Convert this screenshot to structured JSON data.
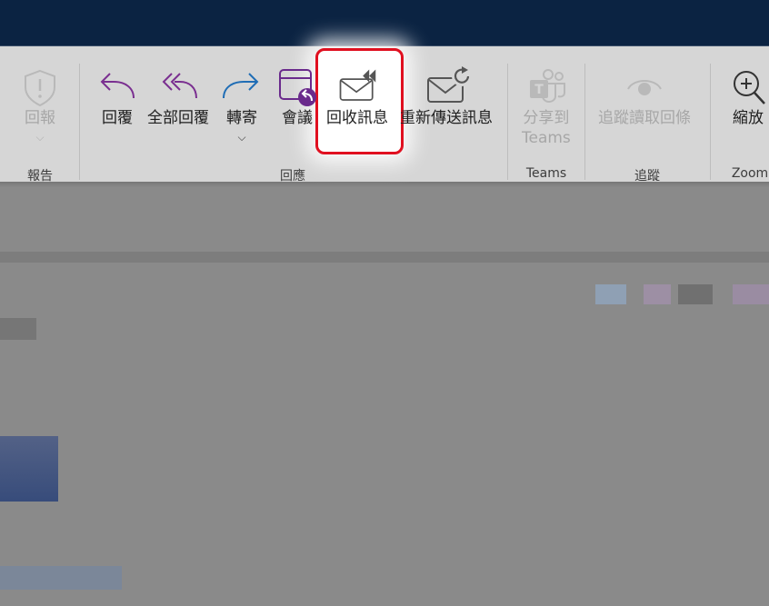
{
  "ribbon": {
    "report": {
      "label": "回報",
      "group": "報告"
    },
    "respond": {
      "group": "回應",
      "reply": "回覆",
      "reply_all": "全部回覆",
      "forward": "轉寄",
      "meeting": "會議",
      "recall": "回收訊息",
      "resend": "重新傳送訊息"
    },
    "teams": {
      "label_line1": "分享到",
      "label_line2": "Teams",
      "group": "Teams"
    },
    "tracking": {
      "label": "追蹤讀取回條",
      "group": "追蹤"
    },
    "zoom": {
      "label": "縮放",
      "group": "Zoom"
    }
  },
  "colors": {
    "titlebar": "#0b2342",
    "highlight_border": "#e01020",
    "meeting_badge": "#6a2a8c",
    "reply_arrow": "#7a2f90",
    "forward_arrow": "#1f6db5"
  }
}
